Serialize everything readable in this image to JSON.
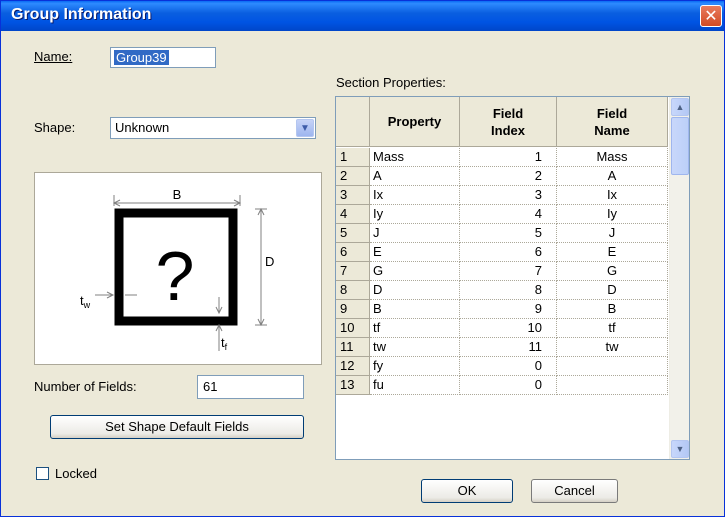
{
  "window": {
    "title": "Group Information",
    "close_glyph": "✕"
  },
  "form": {
    "name_label": "Name:",
    "name_value": "Group39",
    "shape_label": "Shape:",
    "shape_value": "Unknown",
    "fields_label": "Number of Fields:",
    "fields_value": "61",
    "set_default_button": "Set Shape Default Fields",
    "locked_label": "Locked",
    "locked_checked": false
  },
  "diagram": {
    "symbol": "?",
    "width_label": "B",
    "depth_label": "D",
    "web_label": "t",
    "web_sub": "w",
    "flange_label": "t",
    "flange_sub": "f"
  },
  "section": {
    "label": "Section Properties:",
    "columns": [
      {
        "key": "property",
        "label": "Property"
      },
      {
        "key": "field_index",
        "label": "Field Index"
      },
      {
        "key": "field_name",
        "label": "Field Name"
      }
    ],
    "rows": [
      {
        "num": "1",
        "property": "Mass",
        "field_index": "1",
        "field_name": "Mass"
      },
      {
        "num": "2",
        "property": "A",
        "field_index": "2",
        "field_name": "A"
      },
      {
        "num": "3",
        "property": "Ix",
        "field_index": "3",
        "field_name": "Ix"
      },
      {
        "num": "4",
        "property": "Iy",
        "field_index": "4",
        "field_name": "Iy"
      },
      {
        "num": "5",
        "property": "J",
        "field_index": "5",
        "field_name": "J"
      },
      {
        "num": "6",
        "property": "E",
        "field_index": "6",
        "field_name": "E"
      },
      {
        "num": "7",
        "property": "G",
        "field_index": "7",
        "field_name": "G"
      },
      {
        "num": "8",
        "property": "D",
        "field_index": "8",
        "field_name": "D"
      },
      {
        "num": "9",
        "property": "B",
        "field_index": "9",
        "field_name": "B"
      },
      {
        "num": "10",
        "property": "tf",
        "field_index": "10",
        "field_name": "tf"
      },
      {
        "num": "11",
        "property": "tw",
        "field_index": "11",
        "field_name": "tw"
      },
      {
        "num": "12",
        "property": "fy",
        "field_index": "0",
        "field_name": ""
      },
      {
        "num": "13",
        "property": "fu",
        "field_index": "0",
        "field_name": ""
      }
    ]
  },
  "buttons": {
    "ok": "OK",
    "cancel": "Cancel"
  },
  "icons": {
    "dropdown": "chevron-down-icon",
    "scroll_up": "arrow-up-icon",
    "scroll_down": "arrow-down-icon",
    "close": "close-icon"
  },
  "colors": {
    "titlebar": "#0054e3",
    "dialog_bg": "#ece9d8",
    "selection": "#316ac5",
    "close_button": "#d24b24"
  }
}
